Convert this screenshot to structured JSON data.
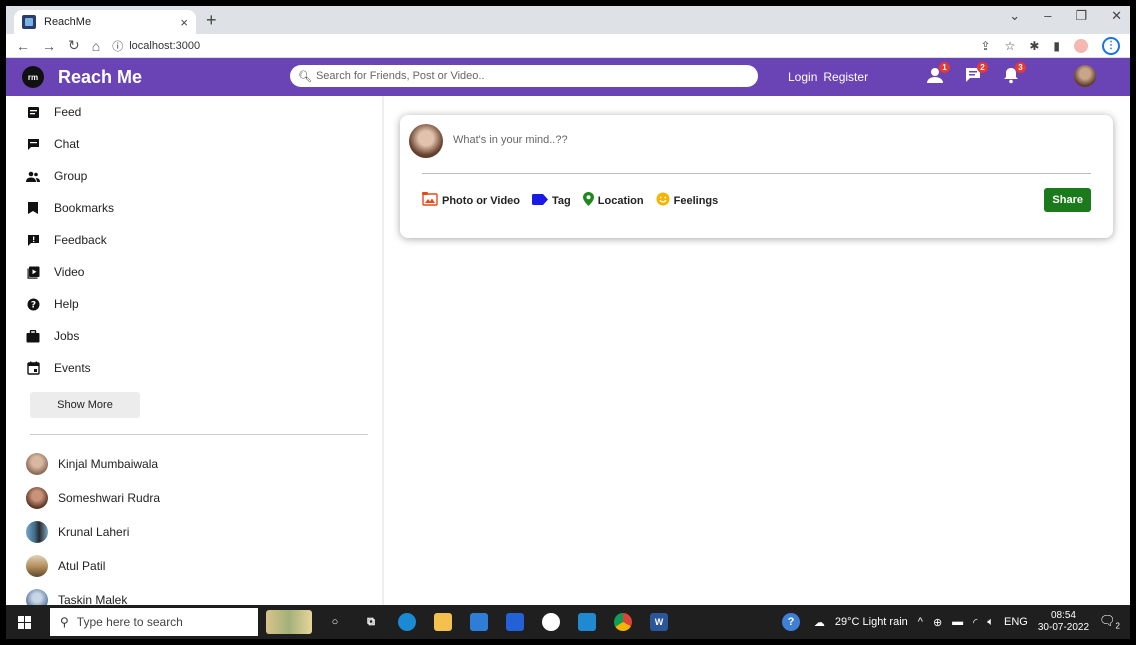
{
  "browser": {
    "tab_title": "ReachMe",
    "tab_close": "×",
    "new_tab": "+",
    "url": "localhost:3000",
    "window_controls": [
      "⌄",
      "–",
      "❐",
      "✕"
    ]
  },
  "app": {
    "brand": "Reach Me",
    "search_placeholder": "Search for Friends, Post or Video..",
    "login": "Login",
    "register": "Register",
    "badges": {
      "friends": "1",
      "messages": "2",
      "notifications": "3"
    }
  },
  "sidebar": {
    "items": [
      {
        "label": "Feed",
        "icon": "feed-icon"
      },
      {
        "label": "Chat",
        "icon": "chat-icon"
      },
      {
        "label": "Group",
        "icon": "group-icon"
      },
      {
        "label": "Bookmarks",
        "icon": "bookmark-icon"
      },
      {
        "label": "Feedback",
        "icon": "feedback-icon"
      },
      {
        "label": "Video",
        "icon": "video-icon"
      },
      {
        "label": "Help",
        "icon": "help-icon"
      },
      {
        "label": "Jobs",
        "icon": "jobs-icon"
      },
      {
        "label": "Events",
        "icon": "events-icon"
      }
    ],
    "show_more": "Show More",
    "friends": [
      {
        "name": "Kinjal Mumbaiwala",
        "color": "#8a6a5a"
      },
      {
        "name": "Someshwari Rudra",
        "color": "#5a3424"
      },
      {
        "name": "Krunal Laheri",
        "color": "#3f6a8a"
      },
      {
        "name": "Atul Patil",
        "color": "#b08a56"
      },
      {
        "name": "Taskin Malek",
        "color": "#5a7aa0"
      }
    ]
  },
  "composer": {
    "placeholder": "What's in your mind..??",
    "actions": [
      {
        "label": "Photo or Video",
        "icon": "photo-icon",
        "color": "#e64a19"
      },
      {
        "label": "Tag",
        "icon": "tag-icon",
        "color": "#1a1ae6"
      },
      {
        "label": "Location",
        "icon": "location-icon",
        "color": "#1b8a1b"
      },
      {
        "label": "Feelings",
        "icon": "feelings-icon",
        "color": "#f4b400"
      }
    ],
    "share": "Share"
  },
  "taskbar": {
    "search_placeholder": "Type here to search",
    "weather": "29°C Light rain",
    "language": "ENG",
    "time": "08:54",
    "date": "30-07-2022",
    "notification_count": "2"
  },
  "colors": {
    "header": "#6a43b5",
    "share": "#1b7a1b",
    "badge": "#e53935"
  }
}
